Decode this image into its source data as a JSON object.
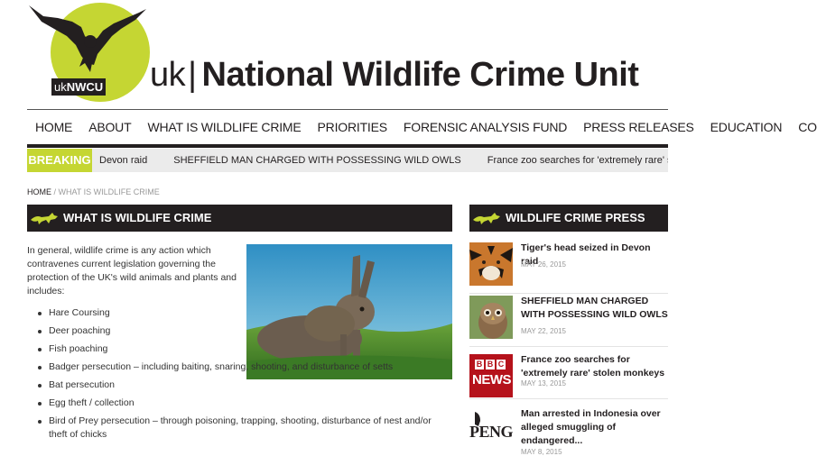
{
  "header": {
    "logo_text_uk": "uk",
    "logo_text_nwcu": "NWCU",
    "title_uk": "uk",
    "title_bar": "|",
    "title_main": "National Wildlife Crime Unit"
  },
  "nav": {
    "items": [
      "HOME",
      "ABOUT",
      "WHAT IS WILDLIFE CRIME",
      "PRIORITIES",
      "FORENSIC ANALYSIS FUND",
      "PRESS RELEASES",
      "EDUCATION",
      "CONTACT"
    ]
  },
  "breaking": {
    "label": "BREAKING",
    "items": [
      "Devon raid",
      "SHEFFIELD MAN CHARGED WITH POSSESSING WILD OWLS",
      "France zoo searches for 'extremely rare' stolen m"
    ]
  },
  "breadcrumb": {
    "home": "HOME",
    "separator": " / ",
    "current": "WHAT IS WILDLIFE CRIME"
  },
  "main": {
    "heading": "WHAT IS WILDLIFE CRIME",
    "intro": "In general, wildlife crime is any action which contravenes current legislation governing the protection of the UK's wild animals and plants and includes:",
    "list": [
      "Hare Coursing",
      "Deer poaching",
      "Fish poaching",
      "Badger persecution – including baiting, snaring, shooting, and disturbance of setts",
      "Bat persecution",
      "Egg theft / collection",
      "Bird of Prey persecution – through poisoning, trapping, shooting, disturbance of nest and/or theft of chicks"
    ]
  },
  "sidebar": {
    "heading": "WILDLIFE CRIME PRESS COVERAGE",
    "items": [
      {
        "title": "Tiger's head seized in Devon raid",
        "date": "MAY 26, 2015",
        "thumb": "tiger"
      },
      {
        "title": "SHEFFIELD MAN CHARGED WITH POSSESSING WILD OWLS",
        "date": "MAY 22, 2015",
        "thumb": "owl"
      },
      {
        "title": "France zoo searches for 'extremely rare' stolen monkeys",
        "date": "MAY 13, 2015",
        "thumb": "bbc-news"
      },
      {
        "title": "Man arrested in Indonesia over alleged smuggling of endangered...",
        "date": "MAY 8, 2015",
        "thumb": "penguin"
      }
    ],
    "bbc_text": "BBC",
    "news_text": "NEWS",
    "pen_text": "PENG"
  },
  "colors": {
    "accent": "#c5d633",
    "dark": "#231f20",
    "breaking_bg": "#ebebeb"
  }
}
